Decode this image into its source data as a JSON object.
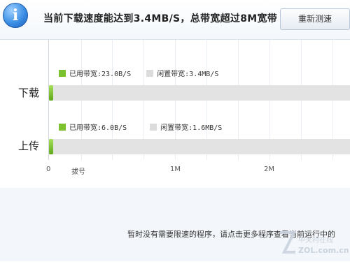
{
  "header": {
    "icon": "info-icon",
    "headline": "当前下载速度能达到3.4MB/S，总带宽超过8M宽带",
    "retest_label": "重新测速"
  },
  "download": {
    "label": "下载",
    "used_label": "已用带宽:23.0B/S",
    "free_label": "闲置带宽:3.4MB/S"
  },
  "upload": {
    "label": "上传",
    "used_label": "已用带宽:6.0B/S",
    "free_label": "闲置带宽:1.6MB/S"
  },
  "axis": {
    "ticks": [
      "0",
      "拔号",
      "1M",
      "2M"
    ]
  },
  "colors": {
    "used": "#7cc22e",
    "free": "#dcdcdc",
    "accent": "#3b8fe5"
  },
  "footer": {
    "status": "暂时没有需要限速的程序，请点击更多程序查看当前运行中的"
  },
  "watermark": {
    "text": "ZOL.com.cn"
  }
}
